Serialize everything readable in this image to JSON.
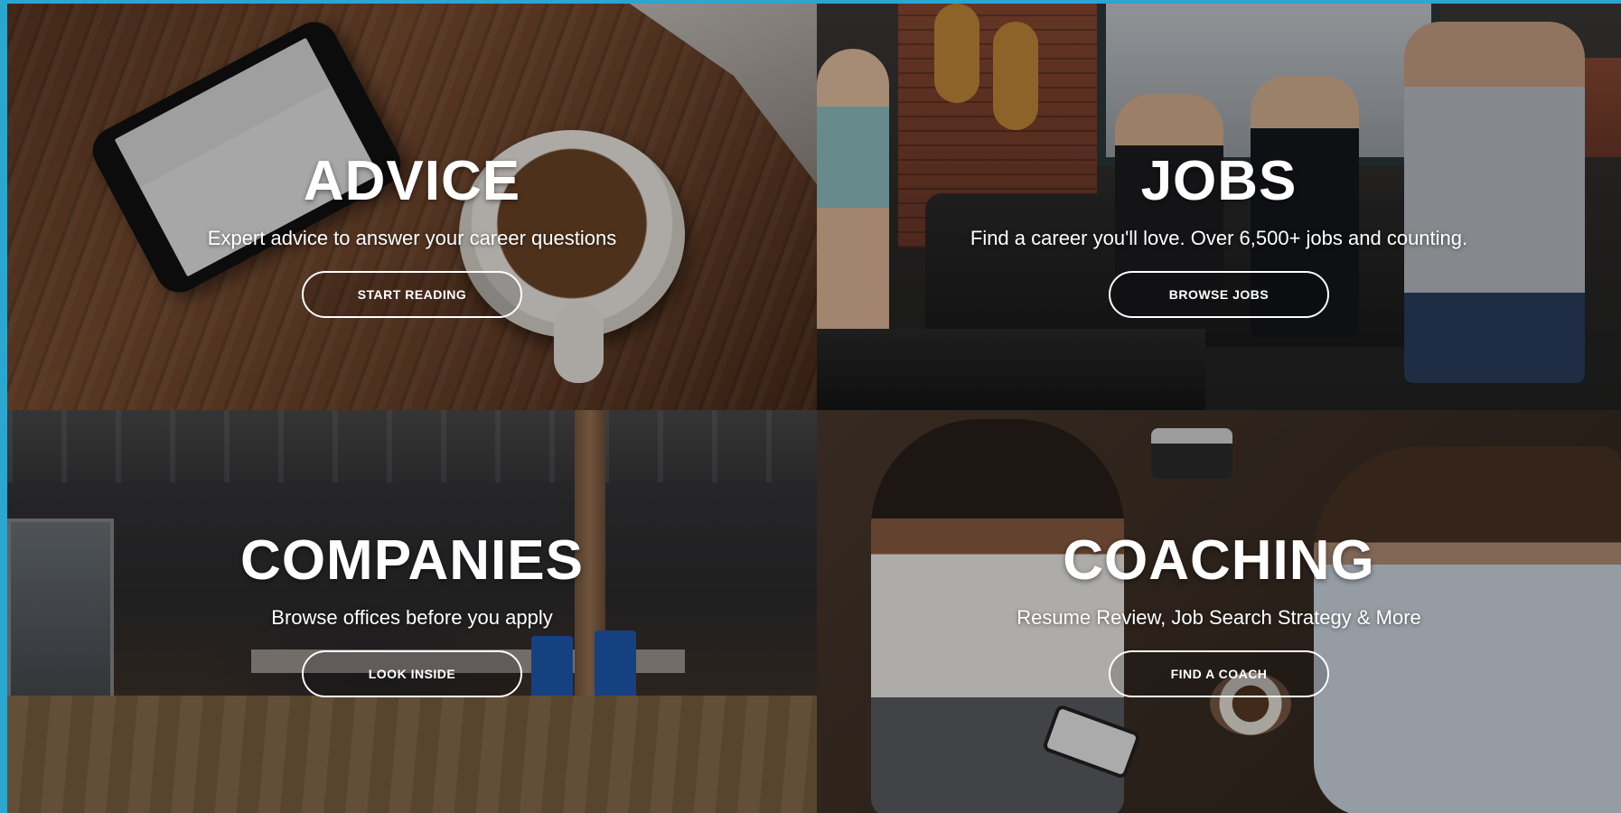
{
  "tiles": [
    {
      "id": "advice",
      "title": "ADVICE",
      "subtitle": "Expert advice to answer your career questions",
      "button": "START READING"
    },
    {
      "id": "jobs",
      "title": "JOBS",
      "subtitle": "Find a career you'll love. Over 6,500+ jobs and counting.",
      "button": "BROWSE JOBS"
    },
    {
      "id": "companies",
      "title": "COMPANIES",
      "subtitle": "Browse offices before you apply",
      "button": "LOOK INSIDE"
    },
    {
      "id": "coaching",
      "title": "COACHING",
      "subtitle": "Resume Review, Job Search Strategy & More",
      "button": "FIND A COACH"
    }
  ],
  "colors": {
    "frame_border": "#2aa6cf",
    "text": "#ffffff"
  }
}
